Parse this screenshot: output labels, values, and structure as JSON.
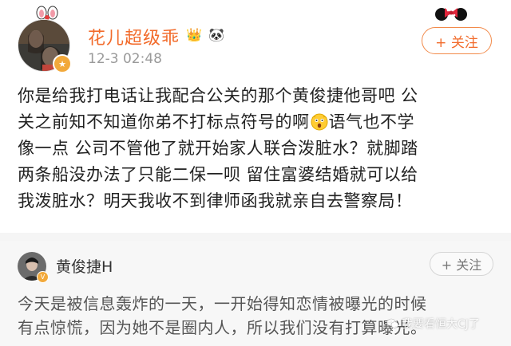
{
  "post": {
    "author": {
      "name": "花儿超级乖",
      "badges": [
        "👑",
        "🐼"
      ]
    },
    "time": "12-3 02:48",
    "follow_label": "+ 关注",
    "body_lines": [
      "你是给我打电话让我配合公关的那个黄俊捷他哥吧 公",
      "关之前知不知道你弟不打标点符号的啊",
      "语气也不学",
      "像一点 公司不管他了就开始家人联合泼脏水？就脚踏",
      "两条船没办法了只能二保一呗 留住富婆结婚就可以给",
      "我泼脏水？明天我收不到律师函我就亲自去警察局！"
    ]
  },
  "quote": {
    "author": {
      "name": "黄俊捷H"
    },
    "follow_label": "+ 关注",
    "text_lines": [
      "今天是被信息轰炸的一天，一开始得知恋情被曝光的时候",
      "有点惊慌，因为她不是圈内人，所以我们没有打算曝光。"
    ]
  },
  "watermark": "我要看恒大CJ了",
  "colors": {
    "username": "#f26b2b",
    "body_text": "#222222",
    "time": "#9a9a9a",
    "quote_bg": "#f7f7f7",
    "verified_badge": "#f2a93b"
  }
}
